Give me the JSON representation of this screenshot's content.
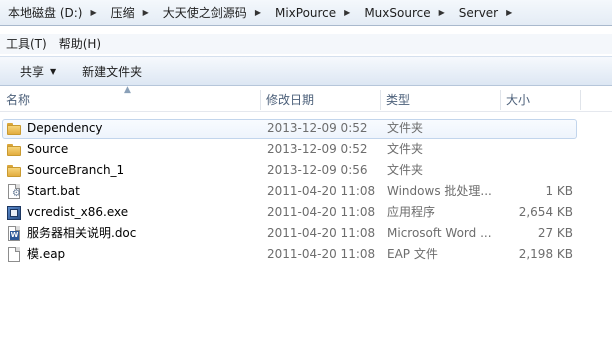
{
  "address": {
    "crumbs": [
      "本地磁盘 (D:)",
      "压缩",
      "大天使之剑源码",
      "MixPource",
      "MuxSource",
      "Server"
    ]
  },
  "menu": {
    "tools": "工具(T)",
    "help": "帮助(H)"
  },
  "commands": {
    "share": "共享",
    "new_folder": "新建文件夹"
  },
  "columns": {
    "name": "名称",
    "date": "修改日期",
    "type": "类型",
    "size": "大小"
  },
  "files": [
    {
      "name": "Dependency",
      "date": "2013-12-09 0:52",
      "type": "文件夹",
      "size": "",
      "icon": "folder-icon",
      "selected": true
    },
    {
      "name": "Source",
      "date": "2013-12-09 0:52",
      "type": "文件夹",
      "size": "",
      "icon": "folder-icon",
      "selected": false
    },
    {
      "name": "SourceBranch_1",
      "date": "2013-12-09 0:56",
      "type": "文件夹",
      "size": "",
      "icon": "folder-icon",
      "selected": false
    },
    {
      "name": "Start.bat",
      "date": "2011-04-20 11:08",
      "type": "Windows 批处理...",
      "size": "1 KB",
      "icon": "batch-file-icon",
      "selected": false
    },
    {
      "name": "vcredist_x86.exe",
      "date": "2011-04-20 11:08",
      "type": "应用程序",
      "size": "2,654 KB",
      "icon": "exe-file-icon",
      "selected": false
    },
    {
      "name": "服务器相关说明.doc",
      "date": "2011-04-20 11:08",
      "type": "Microsoft Word ...",
      "size": "27 KB",
      "icon": "word-doc-icon",
      "selected": false
    },
    {
      "name": "模.eap",
      "date": "2011-04-20 11:08",
      "type": "EAP 文件",
      "size": "2,198 KB",
      "icon": "generic-file-icon",
      "selected": false
    }
  ]
}
